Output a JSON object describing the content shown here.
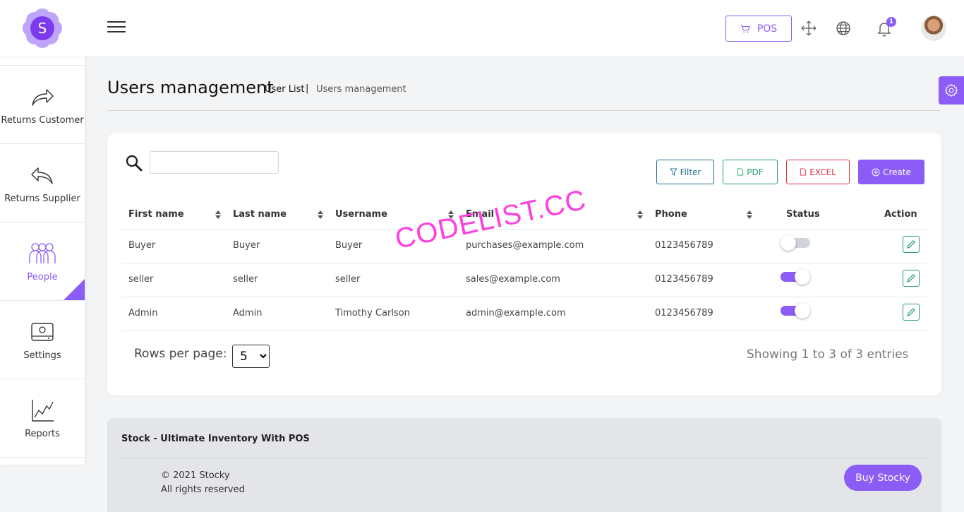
{
  "header": {
    "logo_letter": "S",
    "pos_label": "POS",
    "notification_count": "1",
    "brand_color": "#8b5cf6"
  },
  "sidebar": {
    "items": [
      {
        "label": "Returns Customer",
        "icon": "return-arrow-icon"
      },
      {
        "label": "Returns Supplier",
        "icon": "reply-arrow-icon"
      },
      {
        "label": "People",
        "icon": "people-icon",
        "active": true
      },
      {
        "label": "Settings",
        "icon": "settings-drive-icon"
      },
      {
        "label": "Reports",
        "icon": "chart-icon"
      }
    ]
  },
  "page": {
    "title": "Users management",
    "breadcrumb": [
      "User List",
      "|",
      "Users management"
    ]
  },
  "toolbar": {
    "search_value": "",
    "filter_label": "Filter",
    "pdf_label": "PDF",
    "excel_label": "EXCEL",
    "create_label": "Create"
  },
  "table": {
    "columns": [
      "First name",
      "Last name",
      "Username",
      "Email",
      "Phone",
      "Status",
      "Action"
    ],
    "rows": [
      {
        "first": "Buyer",
        "last": "Buyer",
        "username": "Buyer",
        "email": "purchases@example.com",
        "phone": "0123456789",
        "status": false
      },
      {
        "first": "seller",
        "last": "seller",
        "username": "seller",
        "email": "sales@example.com",
        "phone": "0123456789",
        "status": true
      },
      {
        "first": "Admin",
        "last": "Admin",
        "username": "Timothy Carlson",
        "email": "admin@example.com",
        "phone": "0123456789",
        "status": true
      }
    ]
  },
  "pagination": {
    "rows_label": "Rows per page:",
    "rows_value": "5",
    "showing": "Showing 1 to 3 of 3 entries"
  },
  "watermark": "CODELIST.CC",
  "footer": {
    "title": "Stock - Ultimate Inventory With POS",
    "copyright": "© 2021 Stocky",
    "rights": "All rights reserved",
    "buy_label": "Buy Stocky"
  }
}
